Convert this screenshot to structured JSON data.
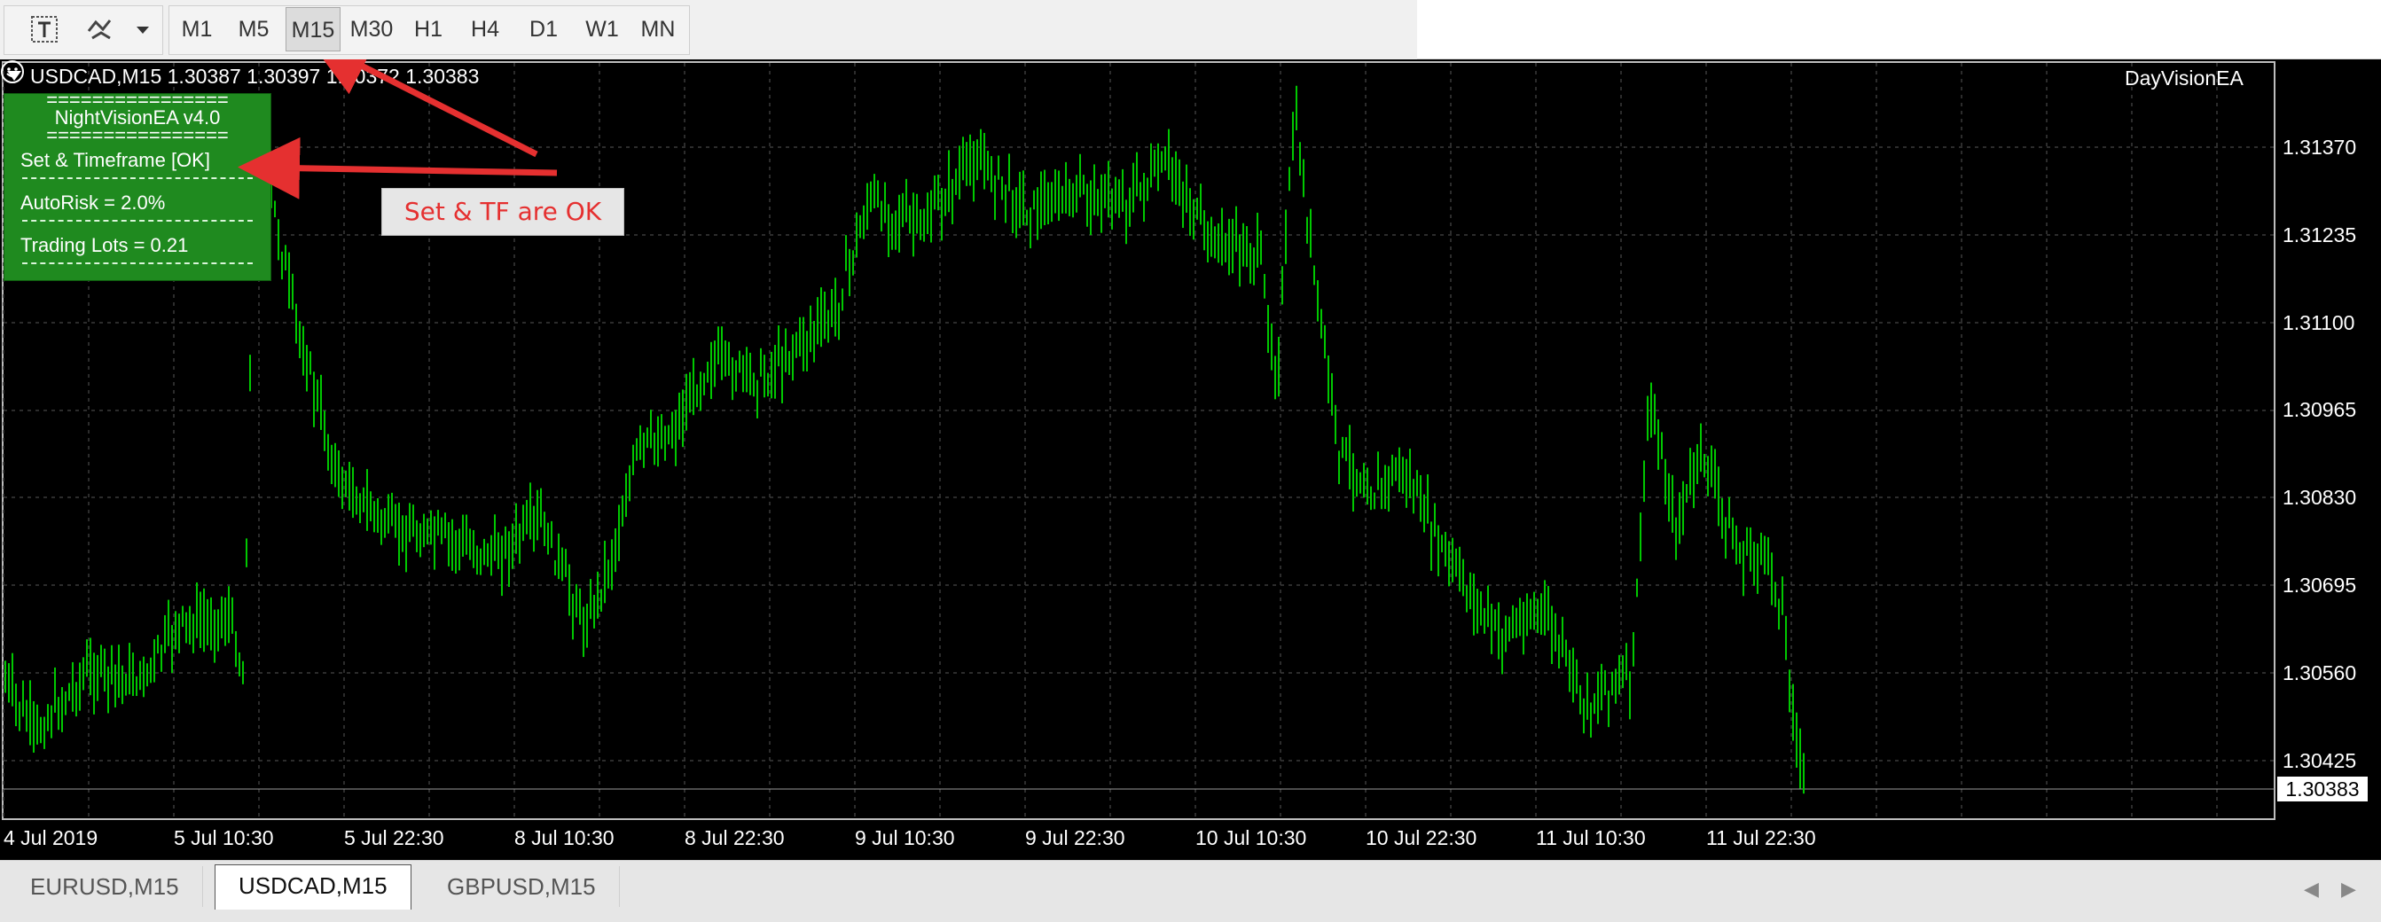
{
  "toolbar": {
    "text_tool_icon": "text-tool-icon",
    "objects_icon": "shapes-icon",
    "dropdown_icon": "chevron-down-icon",
    "timeframes": [
      "M1",
      "M5",
      "M15",
      "M30",
      "H1",
      "H4",
      "D1",
      "W1",
      "MN"
    ],
    "active_timeframe": "M15"
  },
  "chart": {
    "symbol_info": "USDCAD,M15  1.30387 1.30397 1.30372 1.30383",
    "ea_label": "DayVisionEA",
    "smiley_icon": "smiley-icon",
    "price_levels": [
      "1.31370",
      "1.31235",
      "1.31100",
      "1.30965",
      "1.30830",
      "1.30695",
      "1.30560",
      "1.30425"
    ],
    "current_price": "1.30383",
    "time_labels": [
      "4 Jul 2019",
      "5 Jul 10:30",
      "5 Jul 22:30",
      "8 Jul 10:30",
      "8 Jul 22:30",
      "9 Jul 10:30",
      "9 Jul 22:30",
      "10 Jul 10:30",
      "10 Jul 22:30",
      "11 Jul 10:30",
      "11 Jul 22:30"
    ],
    "colors": {
      "background": "#000000",
      "candles": "#00c800",
      "grid": "#3a3a3a"
    }
  },
  "ea_panel": {
    "separator": "================",
    "title": "NightVisionEA v4.0",
    "status": "Set & Timeframe [OK]",
    "autorisk": "AutoRisk = 2.0%",
    "lots": "Trading Lots = 0.21",
    "background": "#1f8a1f"
  },
  "annotation": {
    "text": "Set & TF are OK",
    "color": "#e53030"
  },
  "tabs": [
    {
      "label": "EURUSD,M15",
      "active": false
    },
    {
      "label": "USDCAD,M15",
      "active": true
    },
    {
      "label": "GBPUSD,M15",
      "active": false
    }
  ]
}
